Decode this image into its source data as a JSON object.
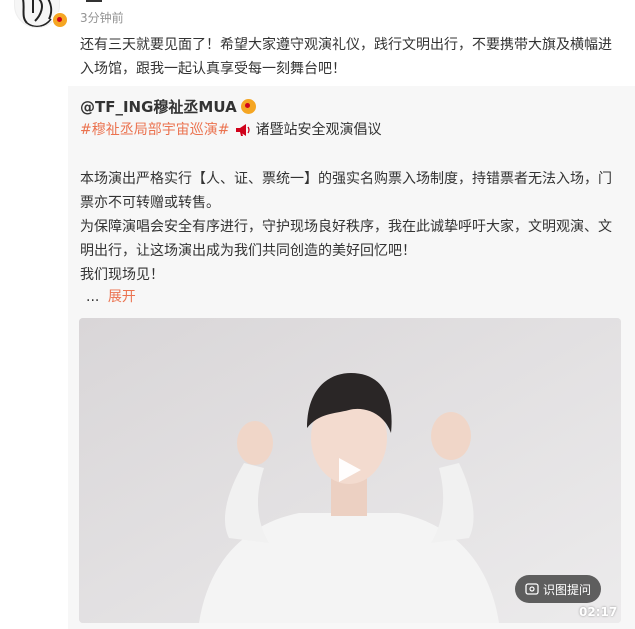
{
  "header": {
    "timestamp": "3分钟前"
  },
  "post": {
    "text": "还有三天就要见面了！希望大家遵守观演礼仪，践行文明出行，不要携带大旗及横幅进入场馆，跟我一起认真享受每一刻舞台吧！"
  },
  "repost": {
    "author": "@TF_ING穆祉丞MUA",
    "topic": "#穆祉丞局部宇宙巡演#",
    "topic_rest": "诸暨站安全观演倡议",
    "paragraphs": [
      "本场演出严格实行【人、证、票统一】的强实名购票入场制度，持错票者无法入场，门票亦不可转赠或转售。",
      "为保障演唱会安全有序进行，守护现场良好秩序，我在此诚挚呼吁大家，文明观演、文明出行，让这场演出成为我们共同创造的美好回忆吧！",
      "我们现场见！"
    ],
    "ellipsis": "...",
    "expand_label": "展开",
    "video": {
      "action_label": "识图提问",
      "duration": "02:17"
    }
  },
  "colors": {
    "accent": "#eb7350",
    "badge": "#f5a623",
    "repost_bg": "#f7f7f7"
  },
  "icons": [
    "avatar",
    "verified-badge-icon",
    "megaphone-icon",
    "play-icon",
    "snapshot-icon"
  ]
}
